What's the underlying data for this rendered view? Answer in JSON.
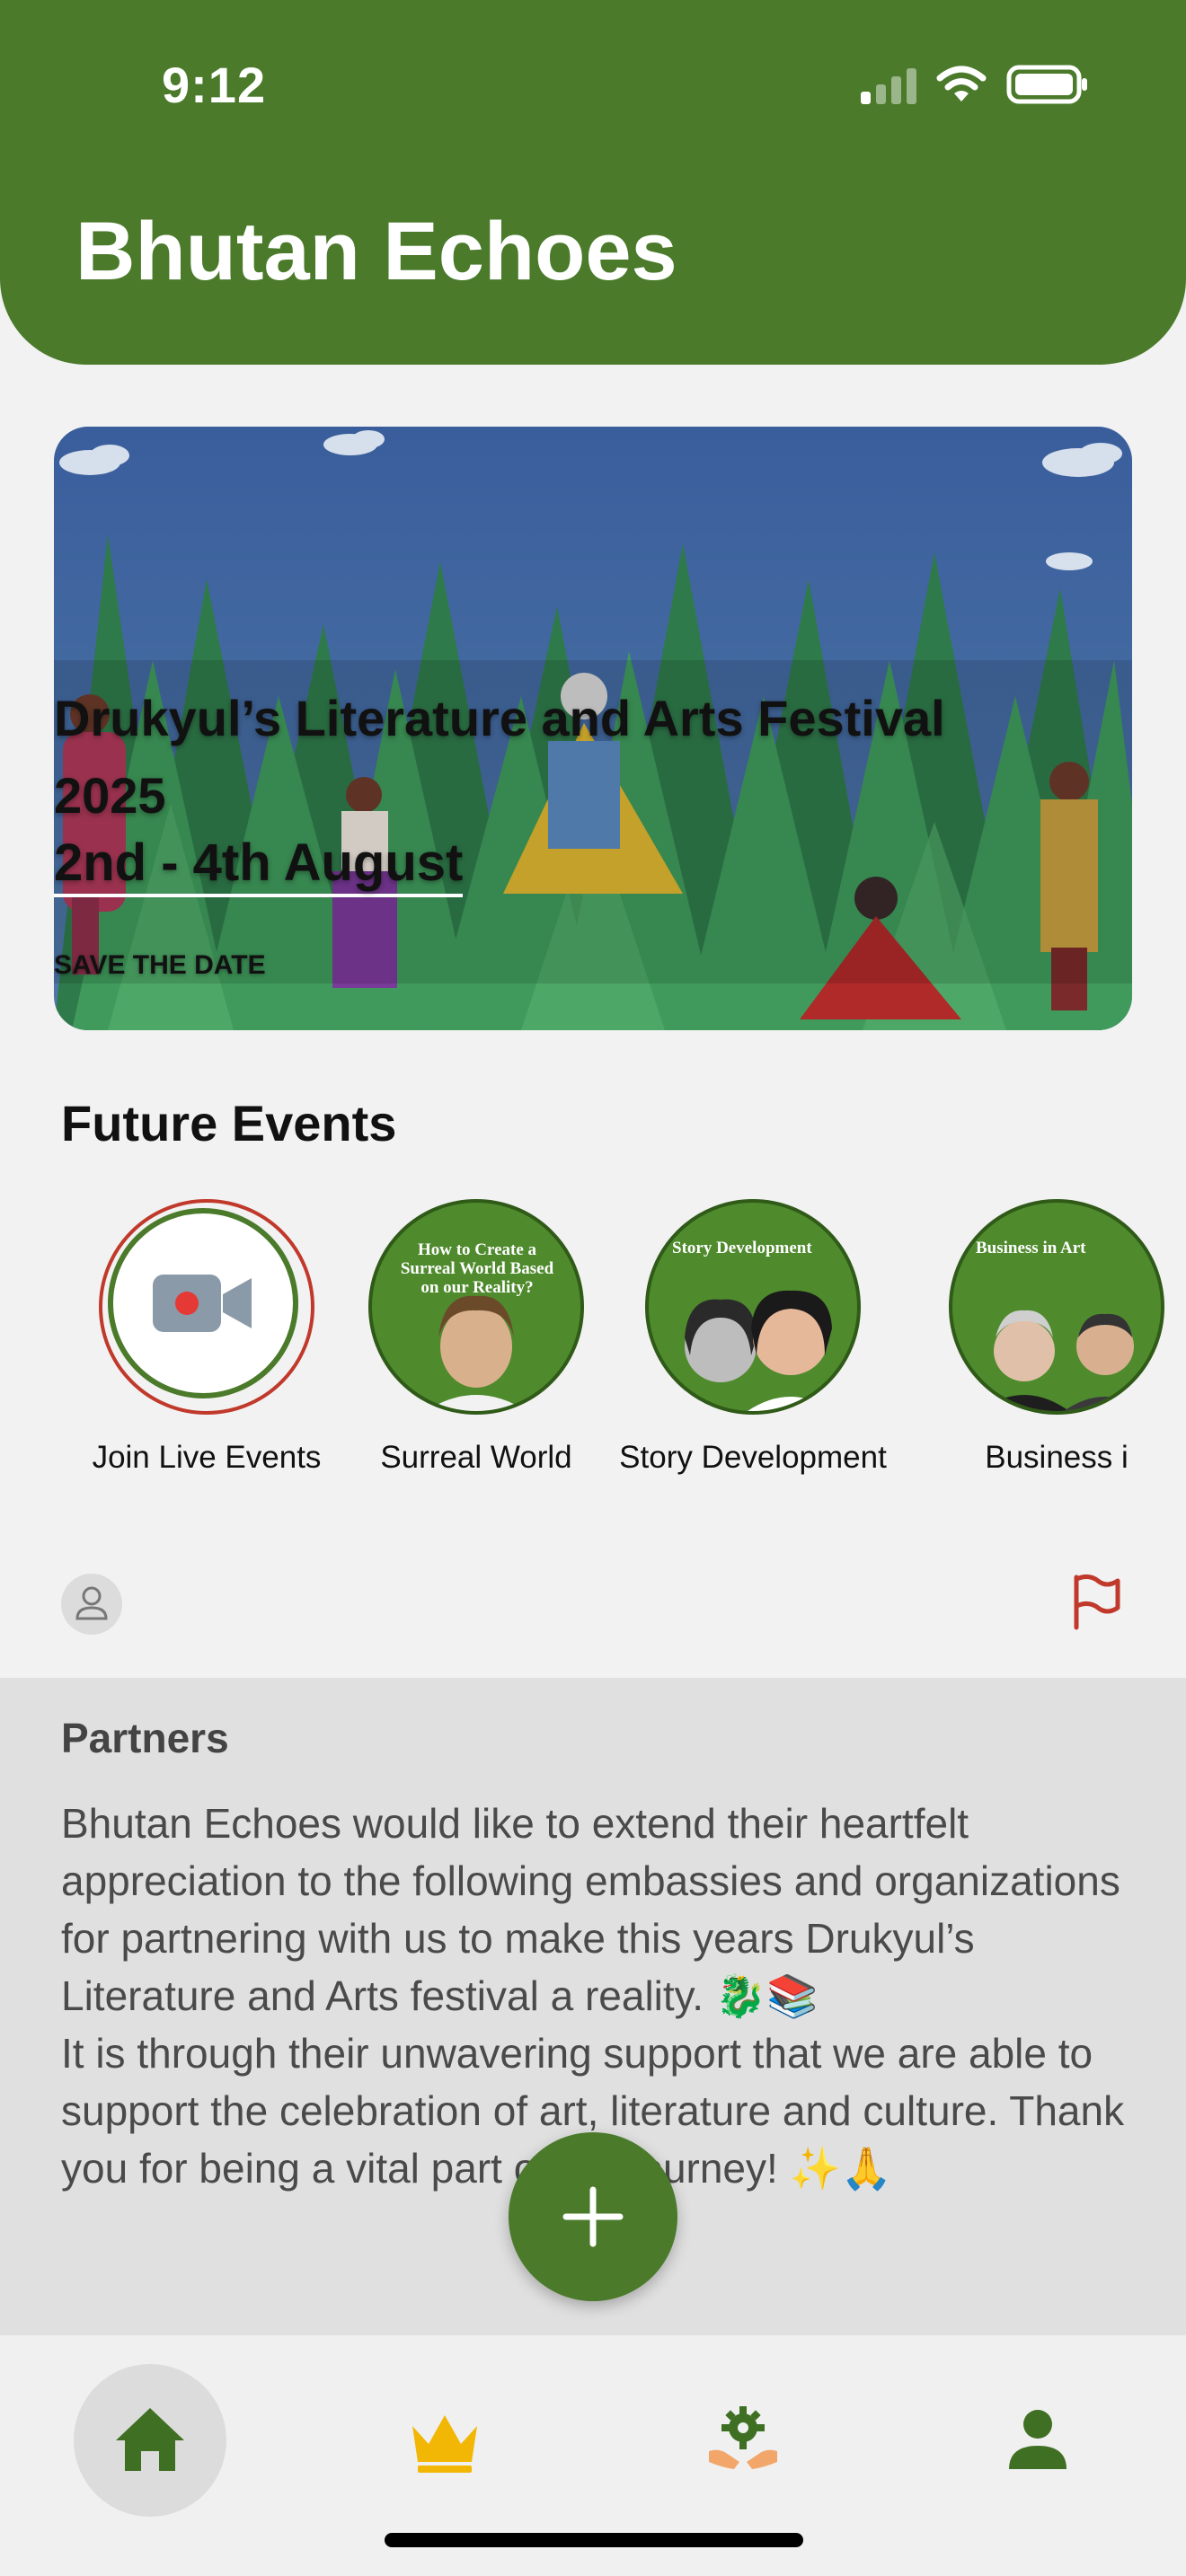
{
  "status_bar": {
    "time": "9:12"
  },
  "header": {
    "title": "Bhutan Echoes"
  },
  "banner": {
    "title_line1": "Drukyul’s Literature and Arts Festival",
    "title_line2": "2025",
    "dates": "2nd - 4th August",
    "save_the_date": "SAVE THE DATE"
  },
  "future_events": {
    "title": "Future Events",
    "items": [
      {
        "label": "Join Live Events",
        "icon": "video-camera-icon"
      },
      {
        "label": "Surreal World",
        "thumb_text": "How to Create a Surreal World Based on our Reality?"
      },
      {
        "label": "Story Development",
        "thumb_text": "Story Development"
      },
      {
        "label": "Business i",
        "thumb_text": "Business in Art"
      }
    ]
  },
  "post": {
    "title": "Partners",
    "body_p1": "Bhutan Echoes would like to extend their heartfelt appreciation to the following embassies and organizations for partnering with us to make this years Drukyul’s Literature and Arts festival a reality. 🐉📚",
    "body_p2": "It is through their unwavering support that we are able to support the celebration of art, literature and culture. Thank you for being a vital part of our journey! ✨🙏"
  },
  "fab": {
    "label": "+"
  },
  "bottom_nav": {
    "items": [
      {
        "name": "home",
        "icon": "home-icon",
        "active": true
      },
      {
        "name": "premium",
        "icon": "crown-icon",
        "active": false
      },
      {
        "name": "community",
        "icon": "hands-gear-icon",
        "active": false
      },
      {
        "name": "profile",
        "icon": "person-icon",
        "active": false
      }
    ]
  },
  "colors": {
    "brand_green": "#4a7a2a",
    "accent_red": "#c0392b",
    "crown_gold": "#f2b705",
    "background": "#f2f2f2"
  }
}
